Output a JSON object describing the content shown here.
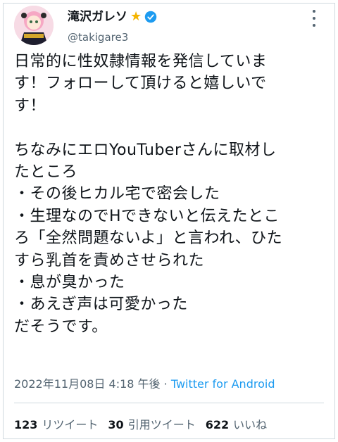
{
  "author": {
    "display_name": "滝沢ガレソ",
    "handle": "@takigare3",
    "badge_icon": "star-icon",
    "verified_icon": "verified-badge-icon"
  },
  "tweet": {
    "text": "日常的に性奴隷情報を発信していま\nす！フォローして頂けると嬉しいで\nす！\n\nちなみにエロYouTuberさんに取材し\nたところ\n・その後ヒカル宅で密会した\n・生理なのでHできないと伝えたとこ\nろ「全然問題ないよ」と言われ、ひた\nすら乳首を責めさせられた\n・息が臭かった\n・あえぎ声は可愛かった\nだそうです。",
    "timestamp": "2022年11月08日 4:18 午後",
    "separator": " · ",
    "source": "Twitter for Android"
  },
  "stats": {
    "retweets_count": "123",
    "retweets_label": "リツイート",
    "quotes_count": "30",
    "quotes_label": "引用ツイート",
    "likes_count": "622",
    "likes_label": "いいね"
  },
  "colors": {
    "accent": "#1d9bf0",
    "star": "#f4b400",
    "text": "#0f1419",
    "muted": "#536471"
  }
}
